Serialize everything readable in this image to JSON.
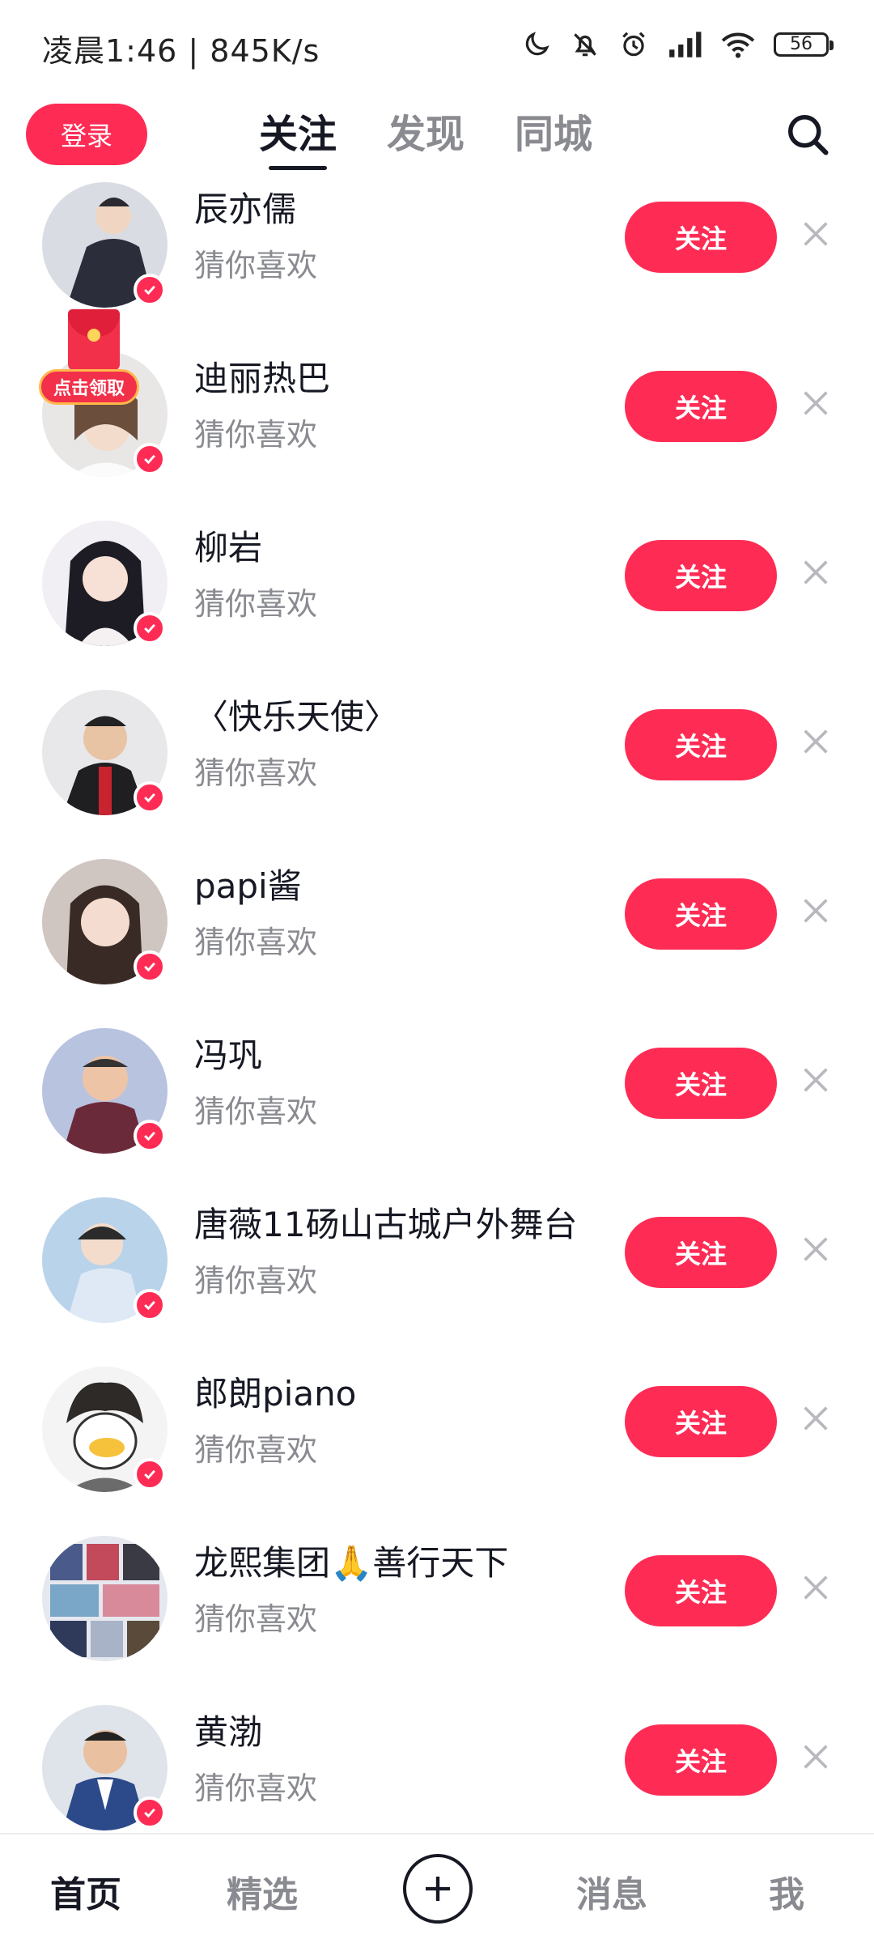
{
  "status_bar": {
    "time_speed": "凌晨1:46 | 845K/s",
    "battery": "56",
    "icons": [
      "moon-icon",
      "bell-off-icon",
      "alarm-icon",
      "signal-icon",
      "wifi-icon",
      "battery-icon"
    ]
  },
  "header": {
    "login_label": "登录",
    "tabs": [
      {
        "label": "关注",
        "active": true
      },
      {
        "label": "发现",
        "active": false
      },
      {
        "label": "同城",
        "active": false
      }
    ],
    "search_icon": "search-icon"
  },
  "colors": {
    "accent": "#fe2c55",
    "text_primary": "#161823",
    "text_secondary": "#8a8b91"
  },
  "suggestions": [
    {
      "name": "辰亦儒",
      "sub": "猜你喜欢",
      "follow_label": "关注"
    },
    {
      "name": "迪丽热巴",
      "sub": "猜你喜欢",
      "follow_label": "关注"
    },
    {
      "name": "柳岩",
      "sub": "猜你喜欢",
      "follow_label": "关注"
    },
    {
      "name": "〈快乐天使〉",
      "sub": "猜你喜欢",
      "follow_label": "关注"
    },
    {
      "name": "papi酱",
      "sub": "猜你喜欢",
      "follow_label": "关注"
    },
    {
      "name": "冯巩",
      "sub": "猜你喜欢",
      "follow_label": "关注"
    },
    {
      "name": "唐薇11砀山古城户外舞台",
      "sub": "猜你喜欢",
      "follow_label": "关注"
    },
    {
      "name": "郎朗piano",
      "sub": "猜你喜欢",
      "follow_label": "关注"
    },
    {
      "name": "龙熙集团🙏善行天下",
      "sub": "猜你喜欢",
      "follow_label": "关注"
    },
    {
      "name": "黄渤",
      "sub": "猜你喜欢",
      "follow_label": "关注"
    }
  ],
  "red_packet": {
    "label": "点击领取"
  },
  "bottom_nav": {
    "items": [
      {
        "label": "首页",
        "active": true
      },
      {
        "label": "精选",
        "active": false
      },
      {
        "label": "消息",
        "active": false
      },
      {
        "label": "我",
        "active": false
      }
    ],
    "add_icon": "plus-icon"
  }
}
